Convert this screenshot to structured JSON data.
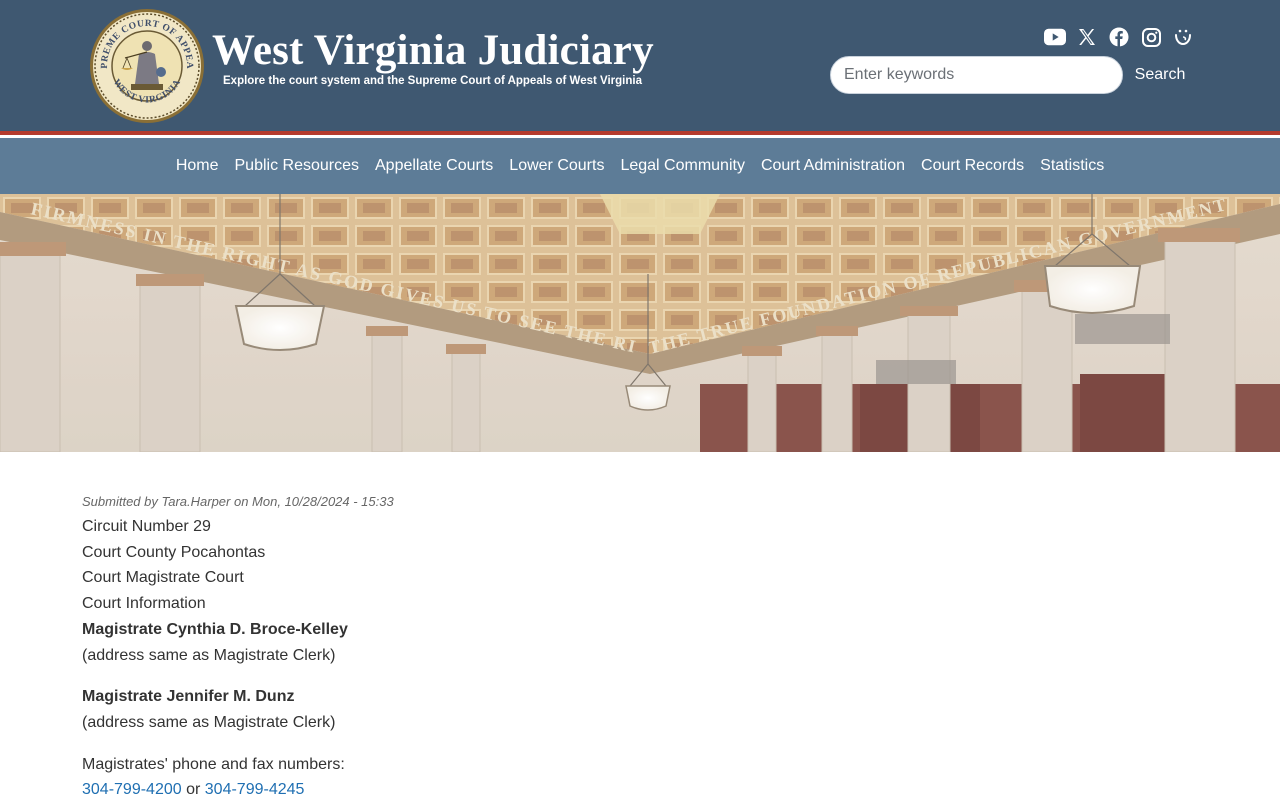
{
  "header": {
    "seal_text_top": "SUPREME COURT OF APPEALS",
    "seal_text_bottom": "WEST VIRGINIA",
    "title": "West Virginia Judiciary",
    "tagline": "Explore the court system and the Supreme Court of Appeals of West Virginia",
    "social_icons": [
      "youtube-icon",
      "x-icon",
      "facebook-icon",
      "instagram-icon",
      "threads-icon"
    ],
    "search": {
      "placeholder": "Enter keywords",
      "value": "",
      "button_label": "Search"
    }
  },
  "nav": {
    "items": [
      {
        "label": "Home"
      },
      {
        "label": "Public Resources"
      },
      {
        "label": "Appellate Courts"
      },
      {
        "label": "Lower Courts"
      },
      {
        "label": "Legal Community"
      },
      {
        "label": "Court Administration"
      },
      {
        "label": "Court Records"
      },
      {
        "label": "Statistics"
      }
    ]
  },
  "hero": {
    "frieze_left": "FIRMNESS IN THE RIGHT AS GOD GIVES US TO SEE THE RIGHT • LINCOLN",
    "frieze_right": "THE TRUE FOUNDATION OF REPUBLICAN GOVERNMENT"
  },
  "content": {
    "submitted": "Submitted by Tara.Harper on Mon, 10/28/2024 - 15:33",
    "circuit": "Circuit Number 29",
    "county": "Court County Pocahontas",
    "court": "Court Magistrate Court",
    "info_heading": "Court Information",
    "magistrate_1": "Magistrate Cynthia D. Broce-Kelley",
    "magistrate_1_address": "(address same as Magistrate Clerk)",
    "magistrate_2": "Magistrate Jennifer M. Dunz",
    "magistrate_2_address": "(address same as Magistrate Clerk)",
    "phones_label": "Magistrates' phone and fax numbers:",
    "phone": "304-799-4200",
    "or": "or",
    "fax": "304-799-4245"
  },
  "colors": {
    "header_bg": "#3f5871",
    "nav_bg": "#5d7c97",
    "accent_red": "#b53b2d",
    "link": "#1f6fb2"
  }
}
